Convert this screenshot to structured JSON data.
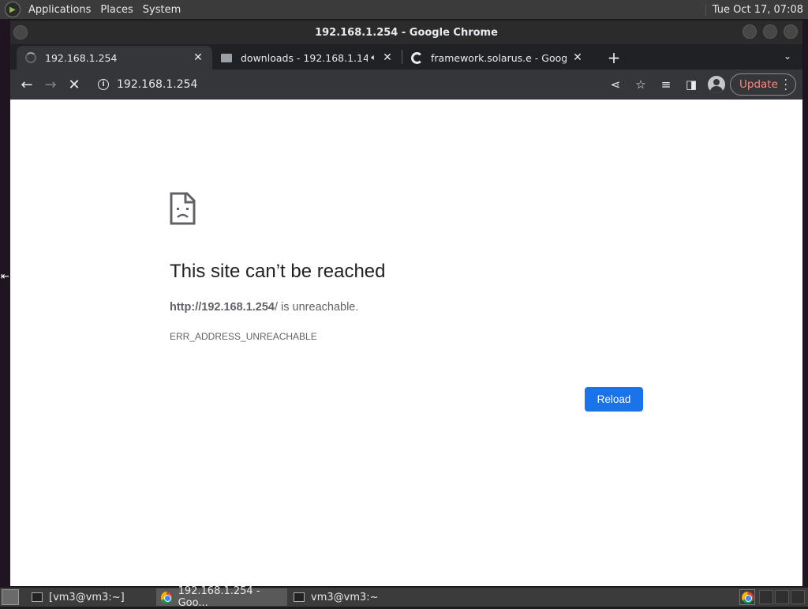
{
  "top_panel": {
    "menus": [
      "Applications",
      "Places",
      "System"
    ],
    "clock": "Tue Oct 17, 07:08"
  },
  "window": {
    "title": "192.168.1.254 - Google Chrome"
  },
  "tabs": [
    {
      "title": "192.168.1.254",
      "icon": "loading-spinner-icon",
      "active": true
    },
    {
      "title": "downloads - 192.168.1.14 >",
      "icon": "folder-icon",
      "active": false,
      "audio": true
    },
    {
      "title": "framework.solarus.e - Google",
      "icon": "google-icon",
      "active": false
    }
  ],
  "toolbar": {
    "url": "192.168.1.254",
    "update_label": "Update"
  },
  "error_page": {
    "title": "This site can’t be reached",
    "url_bold": "http://192.168.1.254",
    "message_suffix": "/ is unreachable.",
    "code": "ERR_ADDRESS_UNREACHABLE",
    "reload_label": "Reload"
  },
  "taskbar": {
    "tasks": [
      {
        "label": "[vm3@vm3:~]",
        "icon": "terminal-icon",
        "active": false
      },
      {
        "label": "192.168.1.254 - Goo...",
        "icon": "chrome-icon",
        "active": true
      },
      {
        "label": "vm3@vm3:~",
        "icon": "terminal-icon",
        "active": false
      }
    ]
  },
  "colors": {
    "accent_blue": "#1a73e8",
    "chrome_dark": "#35363a",
    "update_red": "#f28b82"
  }
}
